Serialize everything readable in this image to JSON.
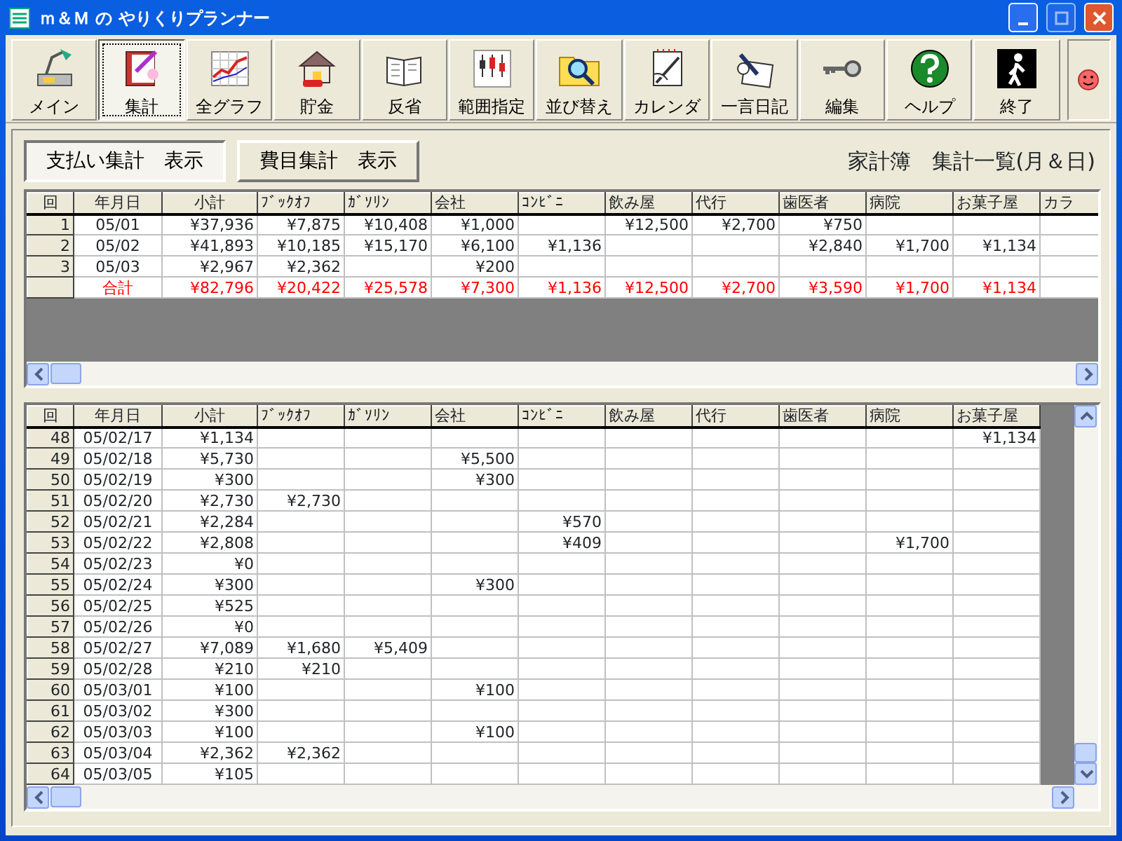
{
  "window": {
    "title": "ｍ＆Ｍ の やりくりプランナー"
  },
  "toolbar": [
    {
      "label": "メイン",
      "selected": false
    },
    {
      "label": "集計",
      "selected": true
    },
    {
      "label": "全グラフ",
      "selected": false
    },
    {
      "label": "貯金",
      "selected": false
    },
    {
      "label": "反省",
      "selected": false
    },
    {
      "label": "範囲指定",
      "selected": false
    },
    {
      "label": "並び替え",
      "selected": false
    },
    {
      "label": "カレンダ",
      "selected": false
    },
    {
      "label": "一言日記",
      "selected": false
    },
    {
      "label": "編集",
      "selected": false
    },
    {
      "label": "ヘルプ",
      "selected": false
    },
    {
      "label": "終了",
      "selected": false
    }
  ],
  "view_buttons": [
    {
      "label": "支払い集計　表示",
      "selected": true
    },
    {
      "label": "費目集計　表示",
      "selected": false
    }
  ],
  "heading": "家計簿　集計一覧(月＆日)",
  "summary_table": {
    "columns": [
      "回",
      "年月日",
      "小計",
      "ﾌﾞｯｸｵﾌ",
      "ｶﾞｿﾘﾝ",
      "会社",
      "ｺﾝﾋﾞﾆ",
      "飲み屋",
      "代行",
      "歯医者",
      "病院",
      "お菓子屋",
      "カラ"
    ],
    "rows": [
      {
        "kind": "data",
        "cells": [
          "1",
          "05/01",
          "¥37,936",
          "¥7,875",
          "¥10,408",
          "¥1,000",
          null,
          "¥12,500",
          "¥2,700",
          "¥750"
        ]
      },
      {
        "kind": "data",
        "cells": [
          "2",
          "05/02",
          "¥41,893",
          "¥10,185",
          "¥15,170",
          "¥6,100",
          "¥1,136",
          null,
          null,
          "¥2,840",
          "¥1,700",
          "¥1,134"
        ]
      },
      {
        "kind": "data",
        "cells": [
          "3",
          "05/03",
          "¥2,967",
          "¥2,362",
          null,
          "¥200"
        ]
      },
      {
        "kind": "total",
        "cells": [
          null,
          "合計",
          "¥82,796",
          "¥20,422",
          "¥25,578",
          "¥7,300",
          "¥1,136",
          "¥12,500",
          "¥2,700",
          "¥3,590",
          "¥1,700",
          "¥1,134"
        ]
      }
    ]
  },
  "detail_table": {
    "columns": [
      "回",
      "年月日",
      "小計",
      "ﾌﾞｯｸｵﾌ",
      "ｶﾞｿﾘﾝ",
      "会社",
      "ｺﾝﾋﾞﾆ",
      "飲み屋",
      "代行",
      "歯医者",
      "病院",
      "お菓子屋"
    ],
    "rows": [
      {
        "kind": "data",
        "cells": [
          "48",
          "05/02/17",
          "¥1,134",
          null,
          null,
          null,
          null,
          null,
          null,
          null,
          null,
          "¥1,134"
        ]
      },
      {
        "kind": "data",
        "cells": [
          "49",
          "05/02/18",
          "¥5,730",
          null,
          null,
          "¥5,500"
        ]
      },
      {
        "kind": "data",
        "cells": [
          "50",
          "05/02/19",
          "¥300",
          null,
          null,
          "¥300"
        ]
      },
      {
        "kind": "data",
        "cells": [
          "51",
          "05/02/20",
          "¥2,730",
          "¥2,730"
        ]
      },
      {
        "kind": "data",
        "cells": [
          "52",
          "05/02/21",
          "¥2,284",
          null,
          null,
          null,
          "¥570"
        ]
      },
      {
        "kind": "data",
        "cells": [
          "53",
          "05/02/22",
          "¥2,808",
          null,
          null,
          null,
          "¥409",
          null,
          null,
          null,
          "¥1,700"
        ]
      },
      {
        "kind": "data",
        "cells": [
          "54",
          "05/02/23",
          "¥0"
        ]
      },
      {
        "kind": "data",
        "cells": [
          "55",
          "05/02/24",
          "¥300",
          null,
          null,
          "¥300"
        ]
      },
      {
        "kind": "data",
        "cells": [
          "56",
          "05/02/25",
          "¥525"
        ]
      },
      {
        "kind": "data",
        "cells": [
          "57",
          "05/02/26",
          "¥0"
        ]
      },
      {
        "kind": "data",
        "cells": [
          "58",
          "05/02/27",
          "¥7,089",
          "¥1,680",
          "¥5,409"
        ]
      },
      {
        "kind": "data",
        "cells": [
          "59",
          "05/02/28",
          "¥210",
          "¥210"
        ]
      },
      {
        "kind": "data",
        "cells": [
          "60",
          "05/03/01",
          "¥100",
          null,
          null,
          "¥100"
        ]
      },
      {
        "kind": "data",
        "cells": [
          "61",
          "05/03/02",
          "¥300"
        ]
      },
      {
        "kind": "data",
        "cells": [
          "62",
          "05/03/03",
          "¥100",
          null,
          null,
          "¥100"
        ]
      },
      {
        "kind": "data",
        "cells": [
          "63",
          "05/03/04",
          "¥2,362",
          "¥2,362"
        ]
      },
      {
        "kind": "data",
        "cells": [
          "64",
          "05/03/05",
          "¥105"
        ]
      }
    ]
  }
}
